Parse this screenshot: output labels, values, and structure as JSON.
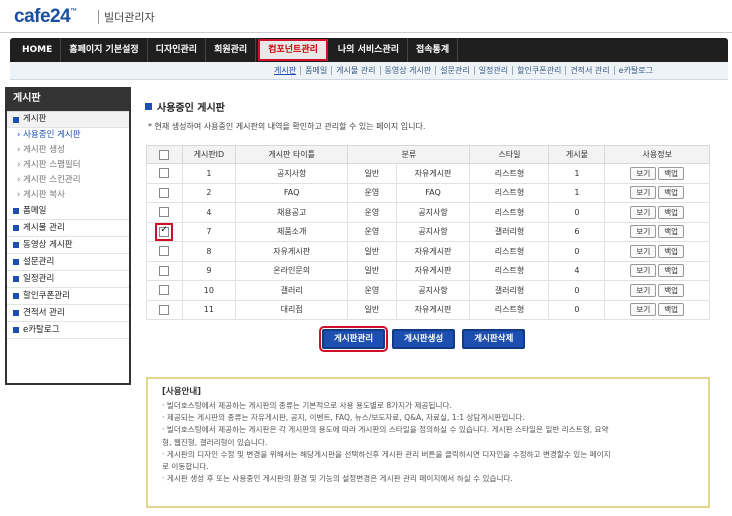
{
  "header": {
    "logo": "cafe24",
    "logo_tm": "™",
    "title": "빌더관리자"
  },
  "nav": {
    "items": [
      "HOME",
      "홈페이지 기본설정",
      "디자인관리",
      "회원관리",
      "컴포넌트관리",
      "나의 서비스관리",
      "접속통계"
    ],
    "active_index": 4
  },
  "subnav": {
    "items": [
      "게시판",
      "폼메일",
      "게시물 관리",
      "동영상 게시판",
      "설문관리",
      "일정관리",
      "할인쿠폰관리",
      "견적서 관리",
      "e카탈로그"
    ],
    "active_index": 0
  },
  "sidebar": {
    "title": "게시판",
    "sections": [
      {
        "label": "게시판",
        "subs": [
          "사용중인 게시판",
          "게시판 생성",
          "게시판 스팸필터",
          "게시판 스킨관리",
          "게시판 복사"
        ]
      },
      {
        "label": "폼메일"
      },
      {
        "label": "게시물 관리"
      },
      {
        "label": "동영상 게시판"
      },
      {
        "label": "설문관리"
      },
      {
        "label": "일정관리"
      },
      {
        "label": "할인쿠폰관리"
      },
      {
        "label": "견적서 관리"
      },
      {
        "label": "e카탈로그"
      }
    ]
  },
  "main": {
    "title": "사용중인 게시판",
    "description": "* 현재 생성하여 사용중인 게시판의 내역을 확인하고 관리할 수 있는 페이지 입니다.",
    "table": {
      "headers": [
        "",
        "게시판ID",
        "게시판 타이틀",
        "분류",
        "스타일",
        "게시물",
        "사용정보"
      ],
      "rows": [
        {
          "checked": false,
          "id": "1",
          "title": "공지사항",
          "cat1": "일반",
          "cat2": "자유게시판",
          "style": "리스트형",
          "count": "1"
        },
        {
          "checked": false,
          "id": "2",
          "title": "FAQ",
          "cat1": "운영",
          "cat2": "FAQ",
          "style": "리스트형",
          "count": "1"
        },
        {
          "checked": false,
          "id": "4",
          "title": "채용공고",
          "cat1": "운영",
          "cat2": "공지사항",
          "style": "리스트형",
          "count": "0"
        },
        {
          "checked": true,
          "id": "7",
          "title": "제품소개",
          "cat1": "운영",
          "cat2": "공지사항",
          "style": "갤러리형",
          "count": "6"
        },
        {
          "checked": false,
          "id": "8",
          "title": "자유게시판",
          "cat1": "일반",
          "cat2": "자유게시판",
          "style": "리스트형",
          "count": "0"
        },
        {
          "checked": false,
          "id": "9",
          "title": "온라인문의",
          "cat1": "일반",
          "cat2": "자유게시판",
          "style": "리스트형",
          "count": "4"
        },
        {
          "checked": false,
          "id": "10",
          "title": "갤러리",
          "cat1": "운영",
          "cat2": "공지사항",
          "style": "갤러리형",
          "count": "0"
        },
        {
          "checked": false,
          "id": "11",
          "title": "대리점",
          "cat1": "일반",
          "cat2": "자유게시판",
          "style": "리스트형",
          "count": "0"
        }
      ],
      "view_label": "보기",
      "backup_label": "백업"
    },
    "buttons": {
      "manage": "게시판관리",
      "create": "게시판생성",
      "delete": "게시판삭제"
    },
    "guide": {
      "title": "[사용안내]",
      "lines": [
        "· 빌더호스팅에서 제공하는 게시판의 종류는 기본적으로 사용 용도별로 8가지가 제공됩니다.",
        "· 제공되는 게시판의 종류는 자유게시판, 공지, 이벤트, FAQ, 뉴스/보도자료, Q&A, 자료실, 1:1 상담게시판입니다.",
        "· 빌더호스팅에서 제공하는 게시판은 각 게시판의 용도에 따라 게시판의 스타일을 정의하실 수 있습니다. 게시판 스타일은 일반 리스트형, 요약",
        "  형, 웹진형, 갤러리형이 있습니다.",
        "· 게시판의 디자인 수정 및 변경을 위해서는 해당게시판을 선택하신후 게시판 관리 버튼을 클릭하시면 디자인을 수정하고 변경할수 있는 페이지",
        "  로 이동합니다.",
        "· 게시판 생성 후 또는 사용중인 게시판의 환경 및 기능의 설정변경은 게시판 관리 페이지에서 하실 수 있습니다."
      ]
    }
  }
}
